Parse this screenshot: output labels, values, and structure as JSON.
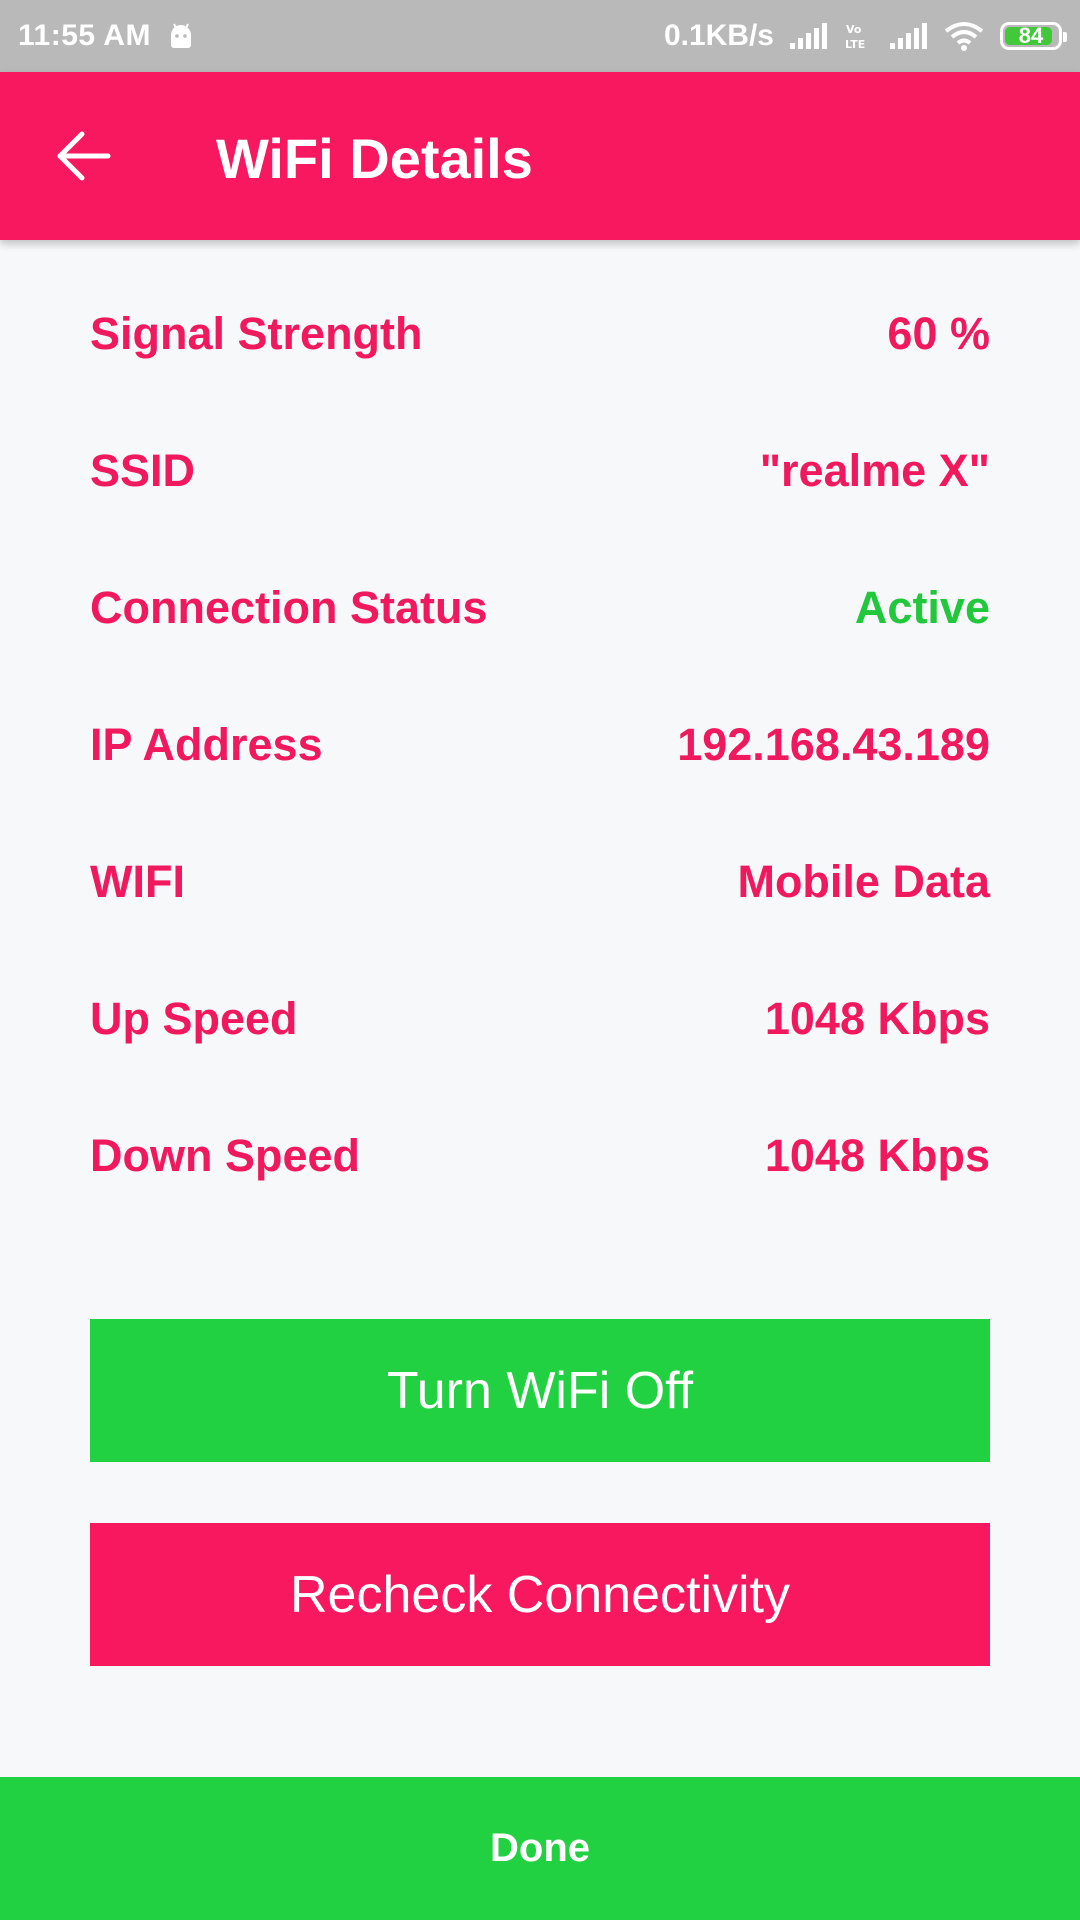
{
  "status_bar": {
    "time": "11:55 AM",
    "network_speed": "0.1KB/s",
    "battery_level": "84",
    "icons": [
      "android-icon",
      "cell-signal-icon",
      "volte-icon",
      "cell-signal-icon",
      "wifi-icon",
      "battery-icon"
    ]
  },
  "app_bar": {
    "title": "WiFi Details",
    "back_icon": "arrow-left-icon"
  },
  "details": [
    {
      "label": "Signal Strength",
      "value": "60 %"
    },
    {
      "label": "SSID",
      "value": "\"realme X\""
    },
    {
      "label": "Connection Status",
      "value": "Active"
    },
    {
      "label": "IP Address",
      "value": "192.168.43.189"
    },
    {
      "label": "WIFI",
      "value": "Mobile Data"
    },
    {
      "label": "Up Speed",
      "value": "1048 Kbps"
    },
    {
      "label": "Down Speed",
      "value": "1048 Kbps"
    }
  ],
  "buttons": {
    "toggle_wifi": "Turn WiFi Off",
    "recheck": "Recheck Connectivity",
    "done": "Done"
  },
  "colors": {
    "primary": "#f8185f",
    "accent_green": "#22d142",
    "status_active": "#22c83c",
    "status_bar": "#b9b9b9"
  }
}
